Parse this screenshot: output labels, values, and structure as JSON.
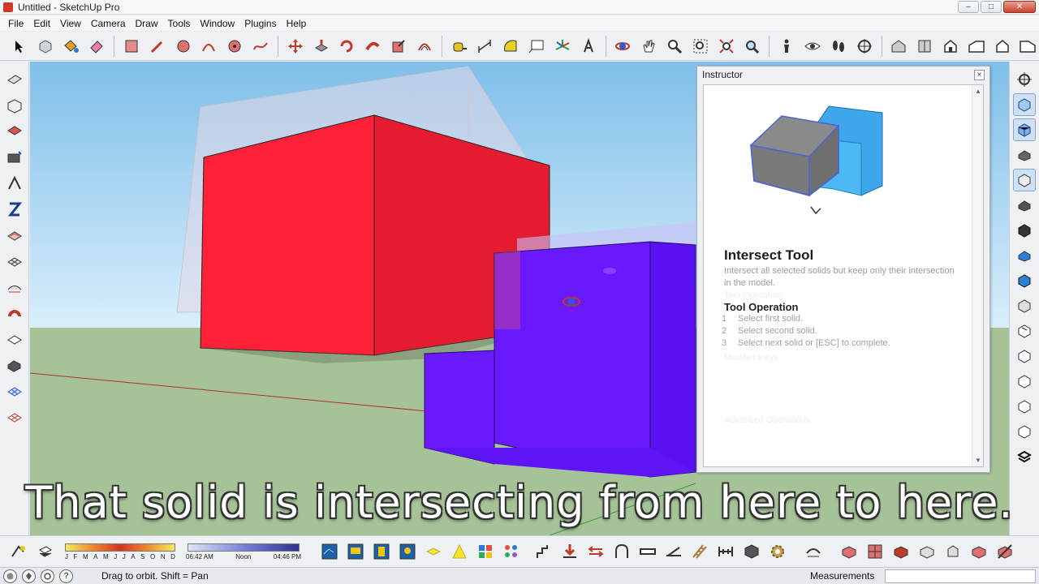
{
  "window": {
    "title": "Untitled - SketchUp Pro",
    "minimize": "–",
    "maximize": "□",
    "close": "✕"
  },
  "menu": [
    "File",
    "Edit",
    "View",
    "Camera",
    "Draw",
    "Tools",
    "Window",
    "Plugins",
    "Help"
  ],
  "instructor": {
    "title": "Instructor",
    "close_glyph": "×",
    "tool_title": "Intersect Tool",
    "description": "Intersect all selected solids but keep only their intersection in the model.",
    "ghost_operation": "Tool Operation",
    "operation_title": "Tool Operation",
    "steps": [
      {
        "num": "1",
        "text": "Select first solid."
      },
      {
        "num": "2",
        "text": "Select second solid."
      },
      {
        "num": "3",
        "text": "Select next solid or [ESC] to complete."
      }
    ],
    "ghost_modifier": "Modifier Keys",
    "ghost_advanced": "Advanced Operations"
  },
  "caption": "That solid is intersecting from here to here.",
  "shadow": {
    "months": [
      "J",
      "F",
      "M",
      "A",
      "M",
      "J",
      "J",
      "A",
      "S",
      "O",
      "N",
      "D"
    ],
    "time_start": "06:42 AM",
    "time_noon": "Noon",
    "time_end": "04:46 PM"
  },
  "status": {
    "hint": "Drag to orbit.  Shift = Pan",
    "measurements_label": "Measurements",
    "measurements_value": "",
    "help_glyph": "?"
  },
  "colors": {
    "red_solid": "#ee1c2c",
    "purple_solid": "#6a19ff",
    "sky_top": "#8fc8ee",
    "ground": "#a9c69a",
    "selection_blue": "#4a63d8"
  }
}
